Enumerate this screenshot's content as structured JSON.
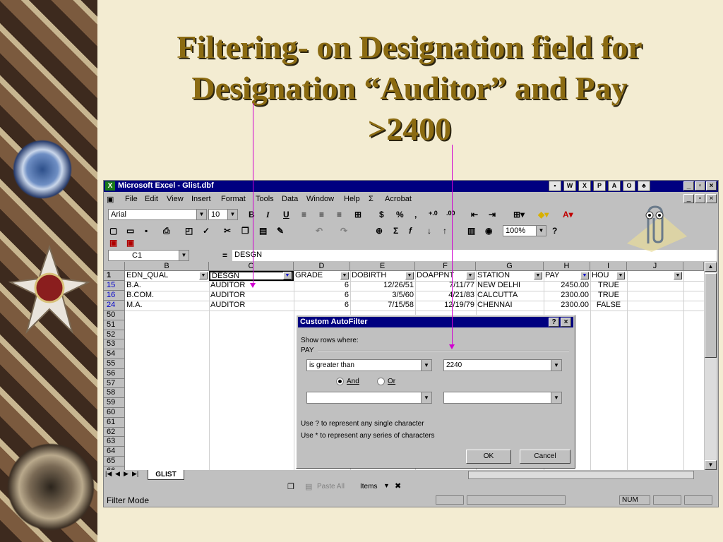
{
  "slide": {
    "title_line1": "Filtering- on Designation field for",
    "title_line2": "Designation “Auditor” and Pay",
    "title_line3": ">2400"
  },
  "window": {
    "title": "Microsoft Excel - Glist.dbf"
  },
  "menu": [
    "File",
    "Edit",
    "View",
    "Insert",
    "Format",
    "Tools",
    "Data",
    "Window",
    "Help",
    "Σ",
    "Acrobat"
  ],
  "format_toolbar": {
    "font": "Arial",
    "size": "10",
    "bold": "B",
    "italic": "I",
    "underline": "U",
    "currency": "$",
    "percent": "%",
    "comma": ","
  },
  "standard_toolbar": {
    "zoom": "100%"
  },
  "formula_bar": {
    "name_box": "C1",
    "equals": "=",
    "content": "DESGN"
  },
  "columns": [
    "B",
    "C",
    "D",
    "E",
    "F",
    "G",
    "H",
    "I",
    "J"
  ],
  "header_row": {
    "row": "1",
    "cells": [
      "EDN_QUAL",
      "DESGN",
      "GRADE",
      "DOBIRTH",
      "DOAPPNT",
      "STATION",
      "PAY",
      "HOU"
    ]
  },
  "data_rows": [
    {
      "row": "15",
      "cells": [
        "B.A.",
        "AUDITOR",
        "6",
        "12/26/51",
        "7/11/77",
        "NEW DELHI",
        "2450.00",
        "TRUE"
      ]
    },
    {
      "row": "16",
      "cells": [
        "B.COM.",
        "AUDITOR",
        "6",
        "3/5/60",
        "4/21/83",
        "CALCUTTA",
        "2300.00",
        "TRUE"
      ]
    },
    {
      "row": "24",
      "cells": [
        "M.A.",
        "AUDITOR",
        "6",
        "7/15/58",
        "12/19/79",
        "CHENNAI",
        "2300.00",
        "FALSE"
      ]
    }
  ],
  "empty_rows": [
    "50",
    "51",
    "52",
    "53",
    "54",
    "55",
    "56",
    "57",
    "58",
    "59",
    "60",
    "61",
    "62",
    "63",
    "64",
    "65",
    "66"
  ],
  "sheet_tab": "GLIST",
  "drawing_bar": {
    "paste_all": "Paste All",
    "items": "Items"
  },
  "status": {
    "mode": "Filter Mode",
    "num": "NUM"
  },
  "dialog": {
    "title": "Custom AutoFilter",
    "show_rows": "Show rows where:",
    "field": "PAY",
    "operator1": "is greater than",
    "value1": "2240",
    "and_label": "And",
    "or_label": "Or",
    "operator2": "",
    "value2": "",
    "hint1": "Use ? to represent any single character",
    "hint2": "Use * to represent any series of characters",
    "ok": "OK",
    "cancel": "Cancel",
    "help": "?",
    "close": "×"
  },
  "colors": {
    "title_text": "#8b6b12",
    "titlebar": "#000080",
    "arrow": "#d000d0",
    "row_number_blue": "#0000cc"
  }
}
